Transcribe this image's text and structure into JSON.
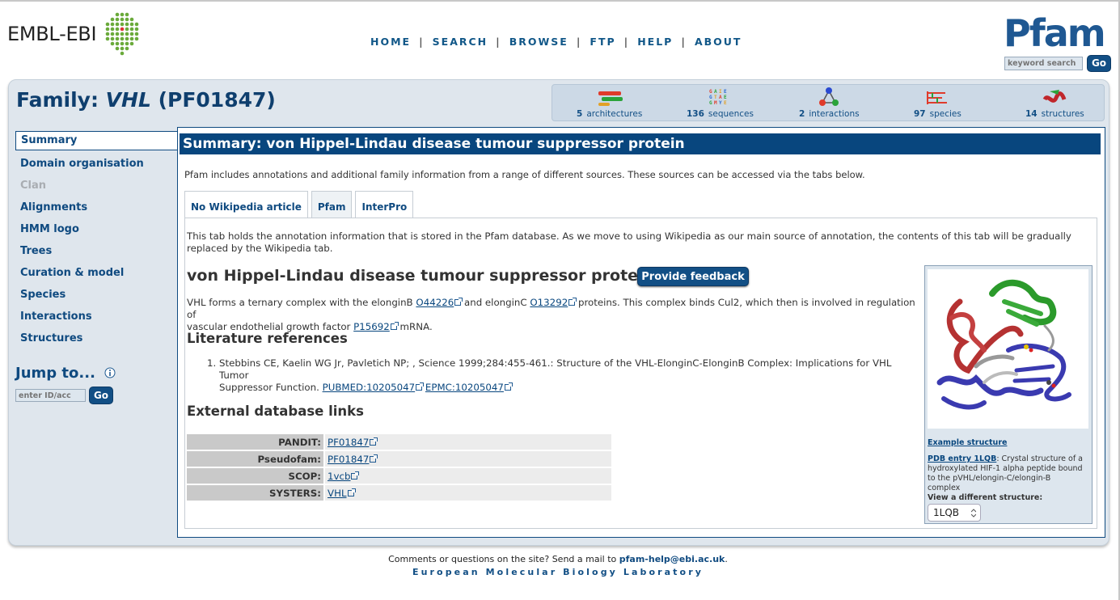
{
  "header": {
    "ebi_logo_text": "EMBL-EBI",
    "nav": [
      "HOME",
      "SEARCH",
      "BROWSE",
      "FTP",
      "HELP",
      "ABOUT"
    ],
    "pfam_logo": "Pfam",
    "keyword_search_placeholder": "keyword search",
    "go_label": "Go"
  },
  "family": {
    "title_prefix": "Family: ",
    "name": "VHL",
    "accession": " (PF01847)"
  },
  "iconbar": [
    {
      "count": "5",
      "label": "architectures",
      "icon": "architectures-icon"
    },
    {
      "count": "136",
      "label": "sequences",
      "icon": "sequences-icon"
    },
    {
      "count": "2",
      "label": "interactions",
      "icon": "interactions-icon"
    },
    {
      "count": "97",
      "label": "species",
      "icon": "species-icon"
    },
    {
      "count": "14",
      "label": "structures",
      "icon": "structures-icon"
    }
  ],
  "sidebar": {
    "items": [
      {
        "label": "Summary"
      },
      {
        "label": "Domain organisation"
      },
      {
        "label": "Clan"
      },
      {
        "label": "Alignments"
      },
      {
        "label": "HMM logo"
      },
      {
        "label": "Trees"
      },
      {
        "label": "Curation & model"
      },
      {
        "label": "Species"
      },
      {
        "label": "Interactions"
      },
      {
        "label": "Structures"
      }
    ],
    "jump_title": "Jump to...",
    "jump_placeholder": "enter ID/acc",
    "go_label": "Go"
  },
  "summary": {
    "heading": "Summary: von Hippel-Lindau disease tumour suppressor protein",
    "intro": "Pfam includes annotations and additional family information from a range of different sources. These sources can be accessed via the tabs below.",
    "tabs": [
      "No Wikipedia article",
      "Pfam",
      "InterPro"
    ],
    "tab_note_line1": "This tab holds the annotation information that is stored in the Pfam database. As we move to using Wikipedia as our main source of annotation, the contents of this tab will be gradually",
    "tab_note_line2": "replaced by the Wikipedia tab.",
    "protein_title": "von Hippel-Lindau disease tumour suppressor protein",
    "feedback_button": "Provide feedback",
    "desc_part1": "VHL forms a ternary complex with the elonginB ",
    "desc_link1": "O44226",
    "desc_part2": " and elonginC ",
    "desc_link2": "O13292",
    "desc_part3": " proteins. This complex binds Cul2, which then is involved in regulation of",
    "desc_line2_part1": "vascular endothelial growth factor ",
    "desc_link3": "P15692",
    "desc_line2_part2": " mRNA.",
    "lit_heading": "Literature references",
    "ref_num": "1.",
    "ref_line1": "Stebbins CE, Kaelin WG Jr, Pavletich NP; , Science 1999;284:455-461.: Structure of the VHL-ElonginC-ElonginB Complex: Implications for VHL Tumor",
    "ref_line2": "Suppressor Function. ",
    "ref_pubmed": "PUBMED:10205047",
    "ref_epmc": "EPMC:10205047",
    "ext_heading": "External database links",
    "db_links": [
      {
        "name": "PANDIT:",
        "value": "PF01847"
      },
      {
        "name": "Pseudofam:",
        "value": "PF01847"
      },
      {
        "name": "SCOP:",
        "value": "1vcb"
      },
      {
        "name": "SYSTERS:",
        "value": "VHL"
      }
    ]
  },
  "structure": {
    "example_label": "Example structure",
    "pdb_link": "PDB entry 1LQB",
    "caption_1": ": Crystal",
    "caption_2": "structure of a",
    "caption_3": "hydroxylated HIF-1 alpha peptide bound",
    "caption_4": "to the pVHL/elongin-C/elongin-B",
    "caption_5": "complex",
    "view_label": "View a different structure:",
    "selected": "1LQB"
  },
  "footer": {
    "line1_text": "Comments or questions on the site? Send a mail to ",
    "email": "pfam-help@ebi.ac.uk",
    "line1_end": ".",
    "line2": "European Molecular Biology Laboratory"
  }
}
